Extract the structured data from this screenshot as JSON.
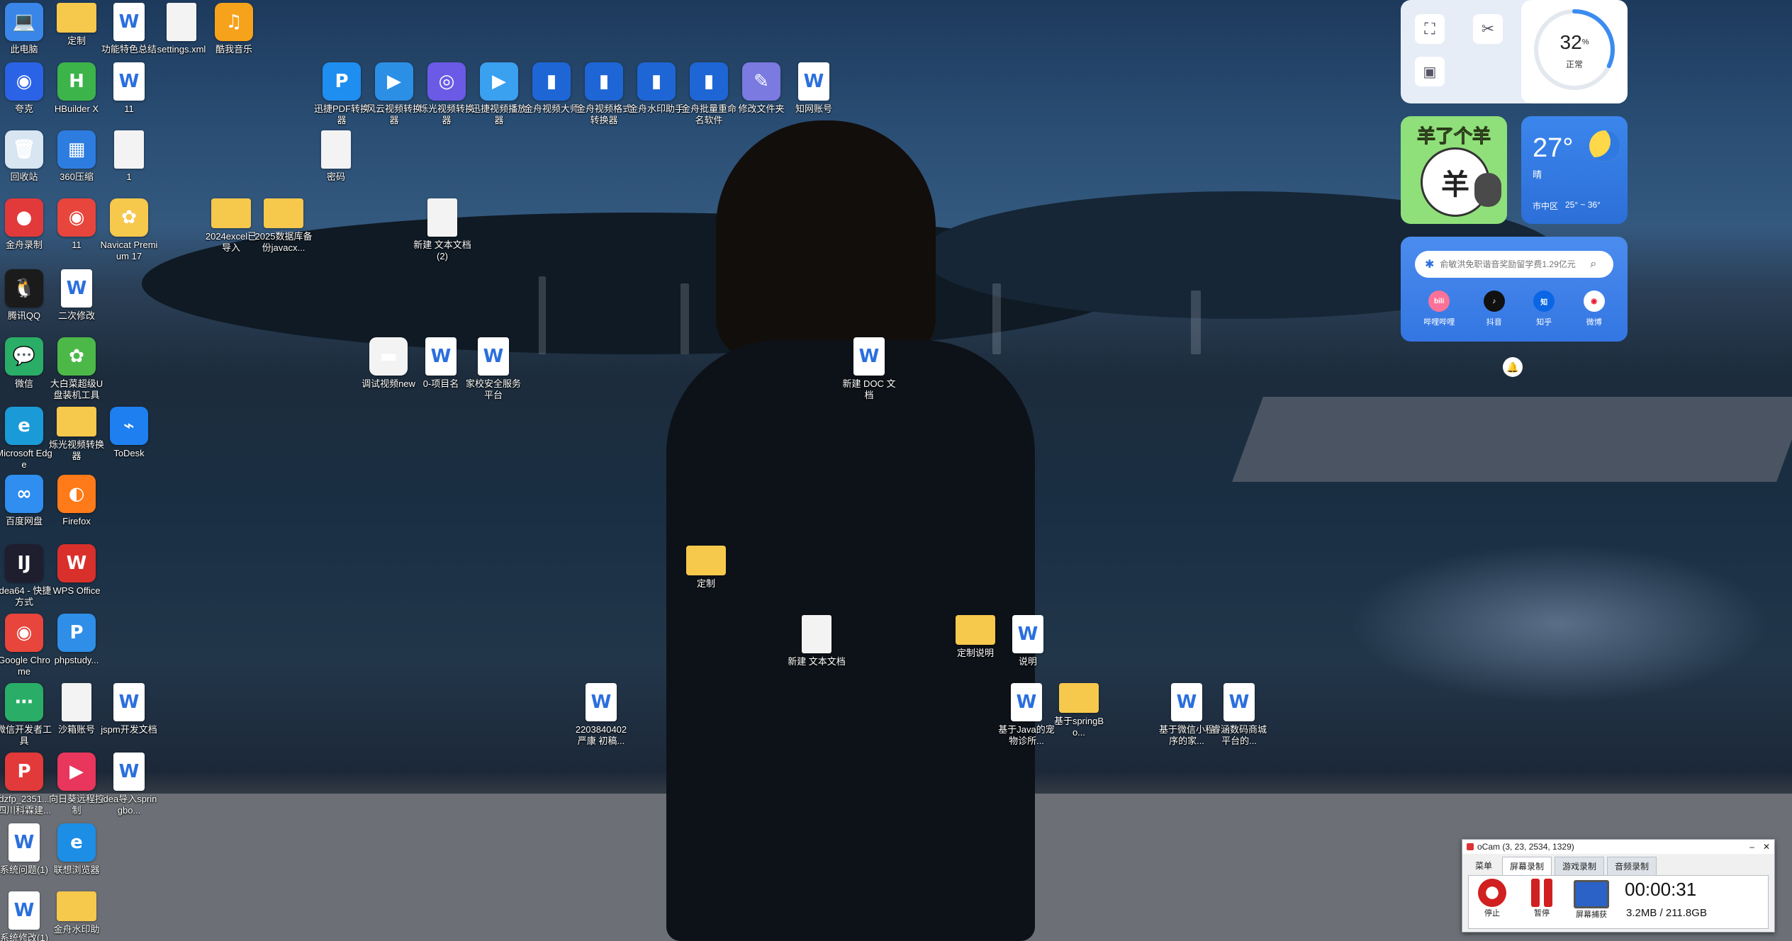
{
  "desktop_icons": [
    {
      "label": "此电脑",
      "glyph": "💻",
      "color": "#3a86e8"
    },
    {
      "label": "定制",
      "glyph": "",
      "color": "#f6c84c"
    },
    {
      "label": "功能特色总结",
      "glyph": "W",
      "color": "#ffffff"
    },
    {
      "label": "settings.xml",
      "glyph": "",
      "color": "#f3f3f3"
    },
    {
      "label": "酷我音乐",
      "glyph": "♫",
      "color": "#f7a21b"
    },
    {
      "label": "夸克",
      "glyph": "◉",
      "color": "#2b63e6"
    },
    {
      "label": "HBuilder X",
      "glyph": "H",
      "color": "#3cb44a"
    },
    {
      "label": "11",
      "glyph": "W",
      "color": "#ffffff"
    },
    {
      "label": "迅捷PDF转换器",
      "glyph": "P",
      "color": "#1e8ef0"
    },
    {
      "label": "风云视频转换器",
      "glyph": "▶",
      "color": "#2c8fe6"
    },
    {
      "label": "烁光视频转换器",
      "glyph": "◎",
      "color": "#6a5ae6"
    },
    {
      "label": "迅捷视频播放器",
      "glyph": "▶",
      "color": "#3aa0f0"
    },
    {
      "label": "金舟视频大师",
      "glyph": "▮",
      "color": "#1e66d6"
    },
    {
      "label": "金舟视频格式转换器",
      "glyph": "▮",
      "color": "#1e66d6"
    },
    {
      "label": "金舟水印助手",
      "glyph": "▮",
      "color": "#1e66d6"
    },
    {
      "label": "金舟批量重命名软件",
      "glyph": "▮",
      "color": "#1e66d6"
    },
    {
      "label": "修改文件夹",
      "glyph": "✎",
      "color": "#7a7ae0"
    },
    {
      "label": "知网账号",
      "glyph": "W",
      "color": "#ffffff"
    },
    {
      "label": "回收站",
      "glyph": "🗑",
      "color": "#d8e6f2"
    },
    {
      "label": "360压缩",
      "glyph": "▦",
      "color": "#2d7de0"
    },
    {
      "label": "1",
      "glyph": "",
      "color": "#f3f3f3"
    },
    {
      "label": "密码",
      "glyph": "",
      "color": "#f3f3f3"
    },
    {
      "label": "金舟录制",
      "glyph": "●",
      "color": "#e23a3a"
    },
    {
      "label": "11",
      "glyph": "◉",
      "color": "#e8453c"
    },
    {
      "label": "Navicat Premium 17",
      "glyph": "✿",
      "color": "#f6c84c"
    },
    {
      "label": "2024excel已导入",
      "glyph": "",
      "color": "#f6c84c"
    },
    {
      "label": "2025数据库备份javacx...",
      "glyph": "",
      "color": "#f6c84c"
    },
    {
      "label": "新建 文本文档 (2)",
      "glyph": "",
      "color": "#f3f3f3"
    },
    {
      "label": "腾讯QQ",
      "glyph": "🐧",
      "color": "#1b1b1b"
    },
    {
      "label": "二次修改",
      "glyph": "W",
      "color": "#ffffff"
    },
    {
      "label": "微信",
      "glyph": "💬",
      "color": "#2aae67"
    },
    {
      "label": "大白菜超级U盘装机工具",
      "glyph": "✿",
      "color": "#4cb848"
    },
    {
      "label": "调试视频new",
      "glyph": "▬",
      "color": "#f3f3f3"
    },
    {
      "label": "0-项目名",
      "glyph": "W",
      "color": "#ffffff"
    },
    {
      "label": "家校安全服务平台",
      "glyph": "W",
      "color": "#ffffff"
    },
    {
      "label": "新建 DOC 文档",
      "glyph": "W",
      "color": "#ffffff"
    },
    {
      "label": "Microsoft Edge",
      "glyph": "e",
      "color": "#1b9ad8"
    },
    {
      "label": "烁光视频转换器",
      "glyph": "",
      "color": "#f6c84c"
    },
    {
      "label": "ToDesk",
      "glyph": "⌁",
      "color": "#1d7ff0"
    },
    {
      "label": "百度网盘",
      "glyph": "∞",
      "color": "#2f8ef0"
    },
    {
      "label": "Firefox",
      "glyph": "◐",
      "color": "#ff7a18"
    },
    {
      "label": "定制",
      "glyph": "",
      "color": "#f6c84c"
    },
    {
      "label": "idea64 - 快捷方式",
      "glyph": "IJ",
      "color": "#1e1e2e"
    },
    {
      "label": "WPS Office",
      "glyph": "W",
      "color": "#d9302c"
    },
    {
      "label": "新建 文本文档",
      "glyph": "",
      "color": "#f3f3f3"
    },
    {
      "label": "定制说明",
      "glyph": "",
      "color": "#f6c84c"
    },
    {
      "label": "说明",
      "glyph": "W",
      "color": "#ffffff"
    },
    {
      "label": "Google Chrome",
      "glyph": "◉",
      "color": "#e8453c"
    },
    {
      "label": "phpstudy...",
      "glyph": "P",
      "color": "#2e8ee8"
    },
    {
      "label": "微信开发者工具",
      "glyph": "⋯",
      "color": "#2aae67"
    },
    {
      "label": "沙箱账号",
      "glyph": "",
      "color": "#f3f3f3"
    },
    {
      "label": "jspm开发文档",
      "glyph": "W",
      "color": "#ffffff"
    },
    {
      "label": "2203840402 严康 初稿...",
      "glyph": "W",
      "color": "#ffffff"
    },
    {
      "label": "基于Java的宠物诊所...",
      "glyph": "W",
      "color": "#ffffff"
    },
    {
      "label": "基于springBo...",
      "glyph": "",
      "color": "#f6c84c"
    },
    {
      "label": "基于微信小程序的家...",
      "glyph": "W",
      "color": "#ffffff"
    },
    {
      "label": "睿涵数码商城平台的...",
      "glyph": "W",
      "color": "#ffffff"
    },
    {
      "label": "dzfp_2351...四川科霖建...",
      "glyph": "P",
      "color": "#e23a3a"
    },
    {
      "label": "向日葵远程控制",
      "glyph": "▶",
      "color": "#e8365c"
    },
    {
      "label": "idea导入springbo...",
      "glyph": "W",
      "color": "#ffffff"
    },
    {
      "label": "系统问题(1)",
      "glyph": "W",
      "color": "#ffffff"
    },
    {
      "label": "联想浏览器",
      "glyph": "e",
      "color": "#1c8ee6"
    },
    {
      "label": "系统修改(1)",
      "glyph": "W",
      "color": "#ffffff"
    },
    {
      "label": "金舟水印助",
      "glyph": "",
      "color": "#f6c84c"
    }
  ],
  "widgets": {
    "battery": {
      "value": "32",
      "unit": "%",
      "status": "正常",
      "percent": 32
    },
    "game": {
      "title": "羊了个羊",
      "center": "羊"
    },
    "weather": {
      "temp": "27°",
      "condition": "晴",
      "location": "巿中区",
      "range": "25° ~ 36°"
    },
    "hot_search": {
      "placeholder": "俞敏洪免职谐音奖励留学费1.29亿元",
      "apps": [
        {
          "label": "哔哩哔哩",
          "color": "#fb7299",
          "glyph": "bili"
        },
        {
          "label": "抖音",
          "color": "#111111",
          "glyph": "♪"
        },
        {
          "label": "知乎",
          "color": "#0a66e4",
          "glyph": "知"
        },
        {
          "label": "微博",
          "color": "#ffffff",
          "glyph": "◉"
        }
      ]
    }
  },
  "ocam": {
    "title": "oCam (3, 23, 2534, 1329)",
    "menu": "菜单",
    "tabs": [
      "屏幕录制",
      "游戏录制",
      "音频录制"
    ],
    "buttons": [
      "停止",
      "暂停",
      "屏幕捕获"
    ],
    "time": "00:00:31",
    "size": "3.2MB / 211.8GB"
  },
  "colors": {
    "accent": "#2b6fde",
    "widget_blue": "#3b7be8",
    "ocam_bg": "#f0f0f0"
  }
}
